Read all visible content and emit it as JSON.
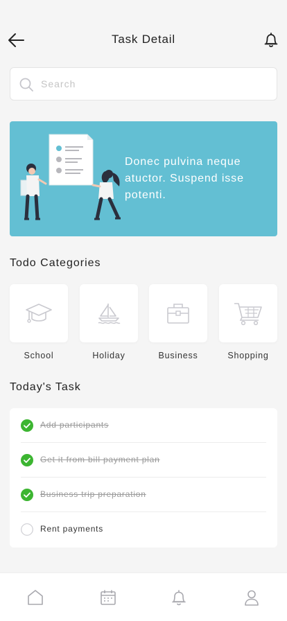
{
  "header": {
    "title": "Task Detail",
    "back_icon": "arrow-left-icon",
    "bell_icon": "bell-icon"
  },
  "search": {
    "placeholder": "Search",
    "value": "",
    "icon": "search-icon"
  },
  "banner": {
    "text": "Donec pulvina neque atuctor. Suspend isse potenti.",
    "background": "#63bfd3"
  },
  "categories": {
    "title": "Todo Categories",
    "items": [
      {
        "label": "School",
        "icon": "graduation-cap-icon"
      },
      {
        "label": "Holiday",
        "icon": "sailboat-icon"
      },
      {
        "label": "Business",
        "icon": "briefcase-icon"
      },
      {
        "label": "Shopping",
        "icon": "shopping-cart-icon"
      }
    ]
  },
  "tasks": {
    "title": "Today's Task",
    "items": [
      {
        "label": "Add participants",
        "done": true
      },
      {
        "label": "Get it from bill payment plan",
        "done": true
      },
      {
        "label": "Business trip preparation",
        "done": true
      },
      {
        "label": "Rent payments",
        "done": false
      }
    ]
  },
  "tabbar": {
    "items": [
      {
        "icon": "home-icon"
      },
      {
        "icon": "calendar-icon"
      },
      {
        "icon": "bell-icon"
      },
      {
        "icon": "user-icon"
      }
    ]
  },
  "colors": {
    "accent": "#63bfd3",
    "check_green": "#3cb531",
    "icon_gray": "#c9c9cf"
  }
}
